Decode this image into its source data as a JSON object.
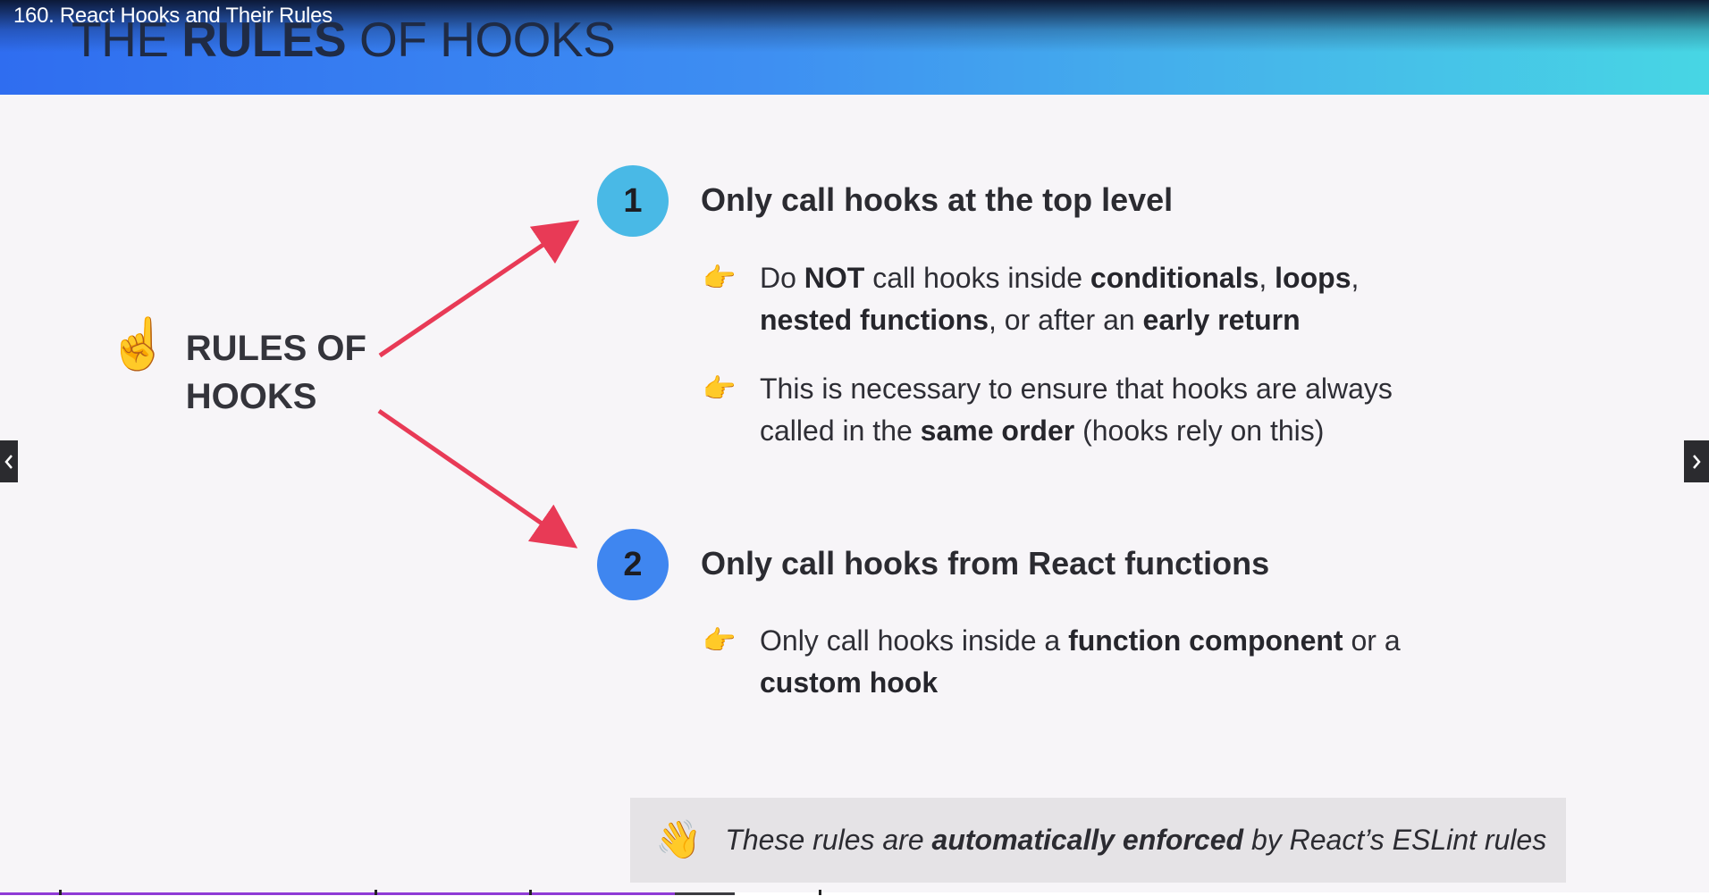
{
  "lecture": {
    "title": "160. React Hooks and Their Rules"
  },
  "slide": {
    "title_pre": "THE ",
    "title_bold": "RULES",
    "title_post": " OF HOOKS",
    "left_label": {
      "emoji": "☝️",
      "text": "RULES OF HOOKS"
    },
    "rules": [
      {
        "number": "1",
        "heading": "Only call hooks at the top level",
        "bullets": [
          {
            "pointer": "👉",
            "parts": [
              {
                "t": "Do "
              },
              {
                "t": "NOT",
                "b": true
              },
              {
                "t": " call hooks inside "
              },
              {
                "t": "conditionals",
                "b": true
              },
              {
                "t": ", "
              },
              {
                "t": "loops",
                "b": true
              },
              {
                "t": ", "
              },
              {
                "t": "nested functions",
                "b": true
              },
              {
                "t": ", or after an "
              },
              {
                "t": "early return",
                "b": true
              }
            ]
          },
          {
            "pointer": "👉",
            "parts": [
              {
                "t": "This is necessary to ensure that hooks are always called in the "
              },
              {
                "t": "same order",
                "b": true
              },
              {
                "t": " (hooks rely on this)"
              }
            ]
          }
        ]
      },
      {
        "number": "2",
        "heading": "Only call hooks from React functions",
        "bullets": [
          {
            "pointer": "👉",
            "parts": [
              {
                "t": "Only call hooks inside a "
              },
              {
                "t": "function component",
                "b": true
              },
              {
                "t": " or a "
              },
              {
                "t": "custom hook",
                "b": true
              }
            ]
          }
        ]
      }
    ],
    "footer_note": {
      "emoji": "👋",
      "parts": [
        {
          "t": "These rules are "
        },
        {
          "t": "automatically enforced",
          "b": true
        },
        {
          "t": " by React’s ESLint rules"
        }
      ]
    }
  },
  "player": {
    "progress": 0.395,
    "buffered": 0.43
  },
  "colors": {
    "circle_1": "#49b9e6",
    "circle_2": "#3f86f0",
    "arrow": "#e83a56",
    "progress": "#8f3bd6"
  }
}
